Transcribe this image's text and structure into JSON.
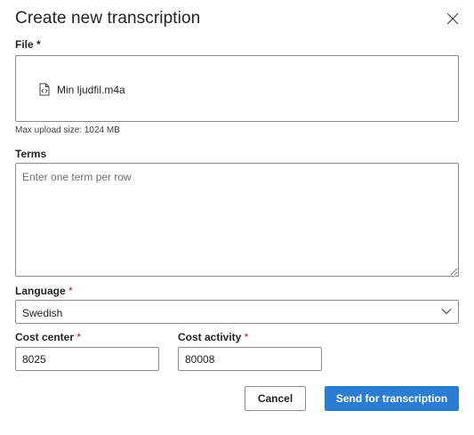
{
  "dialog": {
    "title": "Create new transcription"
  },
  "file": {
    "label": "File",
    "required_mark": "*",
    "file_name": "Min ljudfil.m4a",
    "hint": "Max upload size: 1024 MB"
  },
  "terms": {
    "label": "Terms",
    "placeholder": "Enter one term per row"
  },
  "language": {
    "label": "Language",
    "required_mark": "*",
    "selected": "Swedish"
  },
  "cost_center": {
    "label": "Cost center",
    "required_mark": "*",
    "value": "8025"
  },
  "cost_activity": {
    "label": "Cost activity",
    "required_mark": "*",
    "value": "80008"
  },
  "actions": {
    "cancel_label": "Cancel",
    "submit_label": "Send for transcription"
  },
  "colors": {
    "primary": "#2b7cd3",
    "required": "#c50f1f",
    "border": "#8a8a8a"
  },
  "icons": {
    "close": "close-icon",
    "file": "code-file-icon",
    "dropdown": "chevron-down-icon"
  }
}
